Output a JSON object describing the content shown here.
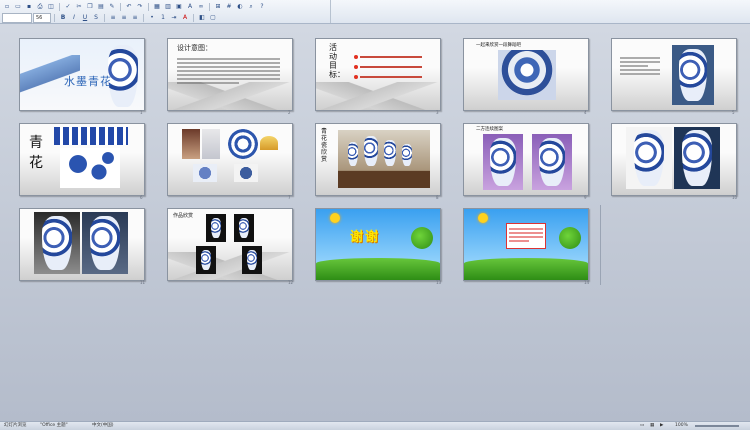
{
  "toolbar": {
    "row1_icons": [
      "new-icon",
      "open-icon",
      "save-icon",
      "print-icon",
      "preview-icon",
      "spell-icon",
      "cut-icon",
      "copy-icon",
      "paste-icon",
      "format-painter-icon",
      "undo-icon",
      "redo-icon",
      "insert-table-icon",
      "chart-icon",
      "zoom-icon",
      "help-icon"
    ],
    "font_size_value": "56",
    "row2_icons": [
      "bold-icon",
      "italic-icon",
      "underline-icon",
      "shadow-icon",
      "align-left-icon",
      "center-icon",
      "align-right-icon",
      "bullets-icon",
      "numbering-icon",
      "font-color-icon",
      "design-icon",
      "new-slide-icon"
    ]
  },
  "slides": [
    {
      "num": "1",
      "title": "水墨青花"
    },
    {
      "num": "2",
      "title": "设计意图："
    },
    {
      "num": "3",
      "title": "活动目标："
    },
    {
      "num": "4",
      "title": "一起来欣赏一段舞蹈吧"
    },
    {
      "num": "5",
      "title": ""
    },
    {
      "num": "6",
      "title": "青花"
    },
    {
      "num": "7",
      "title": ""
    },
    {
      "num": "8",
      "title": "青花瓷欣赏"
    },
    {
      "num": "9",
      "title": "二方连续图案"
    },
    {
      "num": "10",
      "title": ""
    },
    {
      "num": "11",
      "title": ""
    },
    {
      "num": "12",
      "title": "作品欣赏"
    },
    {
      "num": "13",
      "title": "谢谢"
    },
    {
      "num": "14",
      "title": ""
    }
  ],
  "status": {
    "view": "幻灯片浏览",
    "theme": "\"Office 主题\"",
    "language": "中文(中国)",
    "zoom": "100%"
  }
}
